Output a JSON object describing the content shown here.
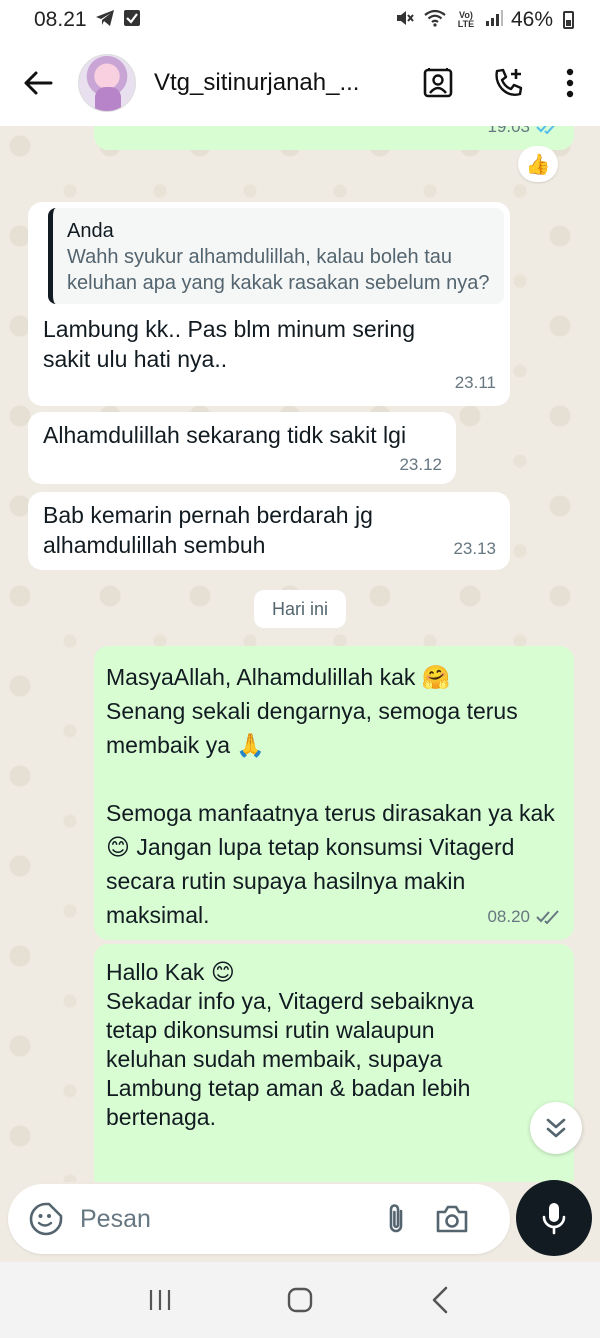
{
  "status": {
    "time": "08.21",
    "network": "Vo) LTE",
    "battery": "46%"
  },
  "header": {
    "contact_name": "Vtg_sitinurjanah_...",
    "icons": [
      "back-arrow-icon",
      "contact-card-icon",
      "add-call-icon",
      "more-vertical-icon"
    ]
  },
  "messages": [
    {
      "id": "m0",
      "direction": "out",
      "time": "19.03",
      "status": "read"
    },
    {
      "id": "m1",
      "direction": "in",
      "quote_author": "Anda",
      "quote_text": "Wahh syukur alhamdulillah, kalau boleh tau keluhan apa yang kakak rasakan sebelum nya?",
      "text": "Lambung kk.. Pas blm minum sering sakit ulu hati nya..",
      "time": "23.11"
    },
    {
      "id": "m2",
      "direction": "in",
      "text": "Alhamdulillah sekarang tidk sakit lgi",
      "time": "23.12"
    },
    {
      "id": "m3",
      "direction": "in",
      "text": "Bab kemarin pernah berdarah jg alhamdulillah sembuh",
      "time": "23.13"
    },
    {
      "id": "m4",
      "direction": "out",
      "text": "MasyaAllah, Alhamdulillah kak 🤗\nSenang sekali dengarnya, semoga terus membaik ya 🙏\n\nSemoga manfaatnya terus dirasakan ya kak 😊 Jangan lupa tetap konsumsi Vitagerd secara rutin supaya hasilnya makin maksimal.",
      "time": "08.20",
      "status": "delivered"
    },
    {
      "id": "m5",
      "direction": "out",
      "text": "Hallo Kak 😊\nSekadar info ya, Vitagerd sebaiknya tetap dikonsumsi rutin walaupun keluhan sudah membaik, supaya Lambung tetap aman & badan lebih bertenaga."
    }
  ],
  "reaction": "👍",
  "date_divider": "Hari ini",
  "input": {
    "placeholder": "Pesan"
  },
  "colors": {
    "incoming_bubble": "#ffffff",
    "outgoing_bubble": "#d9fdd3",
    "chat_background": "#efeae2",
    "read_tick": "#53bdeb",
    "mic_button": "#111b21"
  }
}
